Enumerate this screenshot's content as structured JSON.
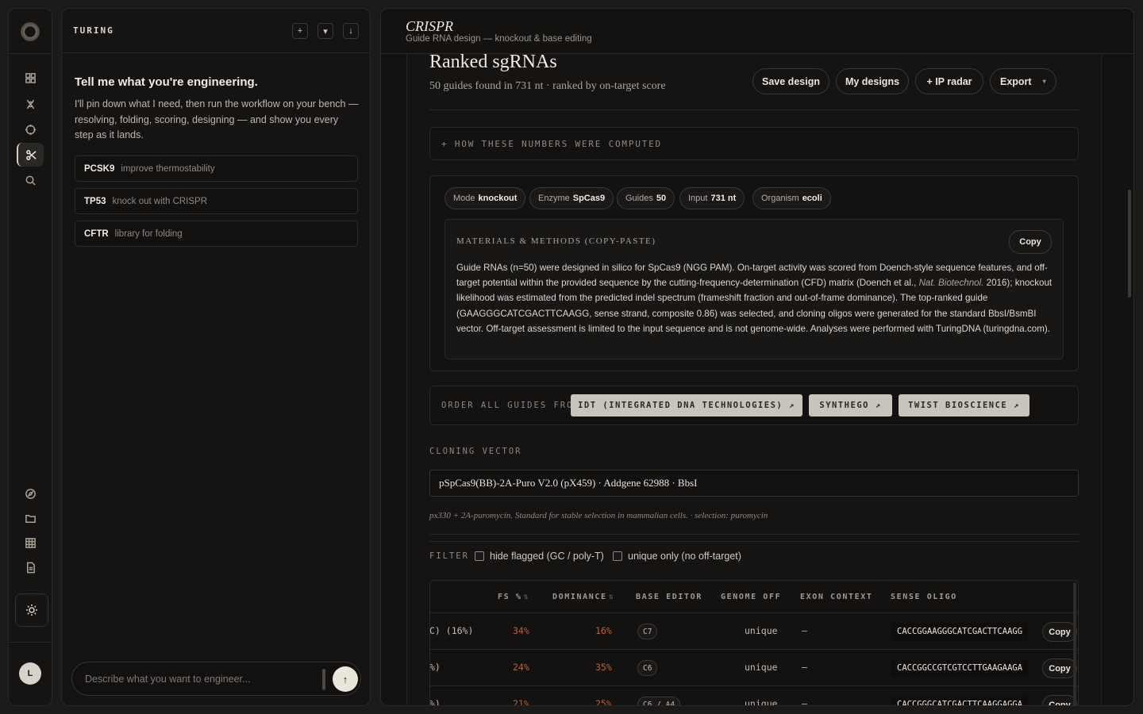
{
  "rail": {
    "nav": [
      "dashboard",
      "dna",
      "target",
      "crispr",
      "search"
    ],
    "bottom": [
      "compass",
      "folder",
      "grid",
      "document"
    ],
    "avatar_initial": "L"
  },
  "chat": {
    "brand": "TURING",
    "intro_title": "Tell me what you're engineering.",
    "intro_body": "I'll pin down what I need, then run the workflow on your bench — resolving, folding, scoring, designing — and show you every step as it lands.",
    "suggestions": [
      {
        "gene": "PCSK9",
        "desc": "improve thermostability"
      },
      {
        "gene": "TP53",
        "desc": "knock out with CRISPR"
      },
      {
        "gene": "CFTR",
        "desc": "library for folding"
      }
    ],
    "composer_placeholder": "Describe what you want to engineer..."
  },
  "header": {
    "title": "CRISPR",
    "subtitle": "Guide RNA design — knockout & base editing"
  },
  "ranked": {
    "title": "Ranked sgRNAs",
    "summary": "50 guides found in 731 nt · ranked by on-target score",
    "actions": {
      "save": "Save design",
      "my_designs": "My designs",
      "ip_radar": "+ IP radar",
      "export": "Export",
      "export_caret": "▾"
    }
  },
  "how_computed": "+ HOW THESE NUMBERS WERE COMPUTED",
  "params": [
    {
      "label": "Mode",
      "value": "knockout"
    },
    {
      "label": "Enzyme",
      "value": "SpCas9"
    },
    {
      "label": "Guides",
      "value": "50"
    },
    {
      "label": "Input",
      "value": "731 nt"
    },
    {
      "label": "Organism",
      "value": "ecoli"
    }
  ],
  "methods": {
    "label": "MATERIALS & METHODS (COPY-PASTE)",
    "copy": "Copy",
    "text_1": "Guide RNAs (n=50) were designed in silico for SpCas9 (NGG PAM). On-target activity was scored from Doench-style sequence features, and off-target potential within the provided sequence by the cutting-frequency-determination (CFD) matrix (Doench et al., ",
    "journal": "Nat. Biotechnol.",
    "text_2": " 2016); knockout likelihood was estimated from the predicted indel spectrum (frameshift fraction and out-of-frame dominance). The top-ranked guide (GAAGGGCATCGACTTCAAGG, sense strand, composite 0.86) was selected, and cloning oligos were generated for the standard BbsI/BsmBI vector. Off-target assessment is limited to the input sequence and is not genome-wide. Analyses were performed with TuringDNA (turingdna.com)."
  },
  "order": {
    "label": "ORDER ALL GUIDES FROM",
    "vendors": [
      "IDT (INTEGRATED DNA TECHNOLOGIES) ↗",
      "SYNTHEGO ↗",
      "TWIST BIOSCIENCE ↗"
    ]
  },
  "cloning": {
    "label": "CLONING VECTOR",
    "selected": "pSpCas9(BB)-2A-Puro V2.0 (pX459) · Addgene 62988 · BbsI",
    "note": "px330 + 2A-puromycin. Standard for stable selection in mammalian cells. · selection: puromycin"
  },
  "filter": {
    "label": "FILTER",
    "options": [
      "hide flagged (GC / poly-T)",
      "unique only (no off-target)"
    ]
  },
  "table": {
    "columns": {
      "fs": "FS %",
      "dominance": "DOMINANCE",
      "base_editor": "BASE EDITOR",
      "genome_off": "GENOME OFF",
      "exon": "EXON CONTEXT",
      "oligo": "SENSE OLIGO",
      "sort_glyph": "⇅"
    },
    "rows": [
      {
        "partial": "C) (16%)",
        "fs": "34%",
        "dominance": "16%",
        "base_editor": "C7",
        "genome_off": "unique",
        "exon": "—",
        "oligo": "CACCGGAAGGGCATCGACTTCAAGG",
        "copy": "Copy"
      },
      {
        "partial": "%)",
        "fs": "24%",
        "dominance": "35%",
        "base_editor": "C6",
        "genome_off": "unique",
        "exon": "—",
        "oligo": "CACCGGCCGTCGTCCTTGAAGAAGA",
        "copy": "Copy"
      },
      {
        "partial": "%)",
        "fs": "21%",
        "dominance": "25%",
        "base_editor": "C6 / A4",
        "genome_off": "unique",
        "exon": "—",
        "oligo": "CACCGGGCATCGACTTCAAGGAGGA",
        "copy": "Copy"
      }
    ]
  },
  "colors": {
    "accent_orange": "#c0622b",
    "vendor_bg": "#c9c4ba",
    "background": "#1b1a18"
  }
}
